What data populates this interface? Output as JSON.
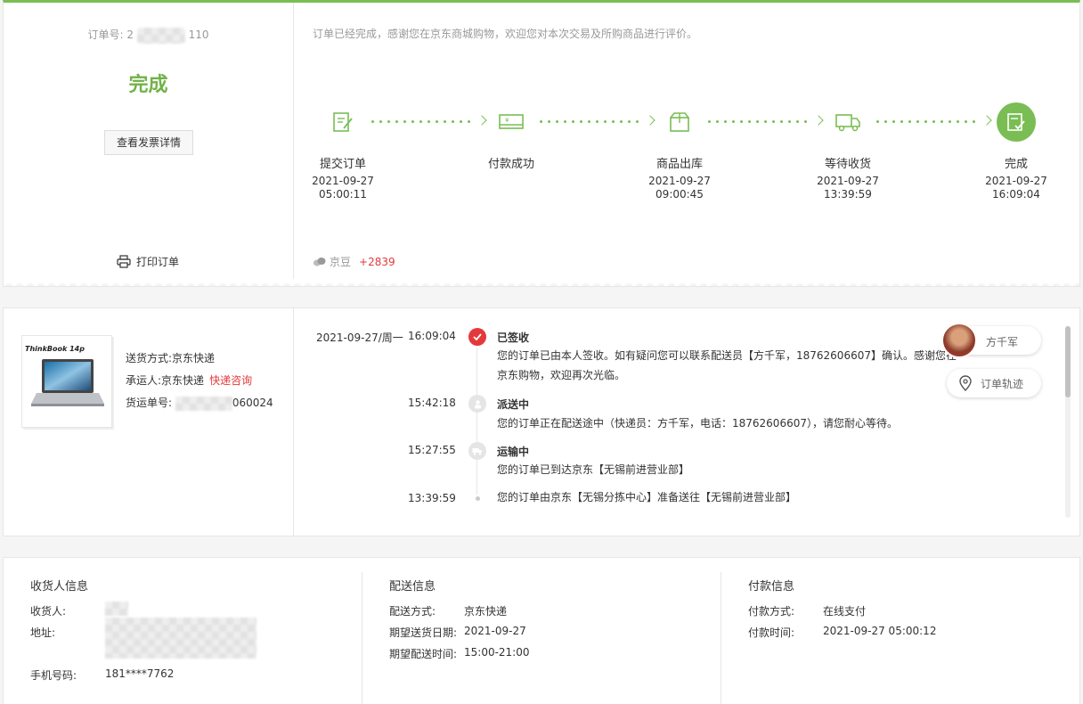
{
  "order": {
    "number_label": "订单号:",
    "number_prefix": "2",
    "number_suffix": "110",
    "status": "完成",
    "invoice_button": "查看发票详情",
    "print_label": "打印订单"
  },
  "summary": {
    "message": "订单已经完成，感谢您在京东商城购物，欢迎您对本次交易及所购商品进行评价。",
    "beans_label": "京豆",
    "beans_value": "+2839"
  },
  "progress": {
    "steps": [
      {
        "name": "提交订单",
        "date": "2021-09-27",
        "time": "05:00:11",
        "icon": "order-form-icon"
      },
      {
        "name": "付款成功",
        "date": "",
        "time": "",
        "icon": "payment-card-icon"
      },
      {
        "name": "商品出库",
        "date": "2021-09-27",
        "time": "09:00:45",
        "icon": "package-icon"
      },
      {
        "name": "等待收货",
        "date": "2021-09-27",
        "time": "13:39:59",
        "icon": "delivery-truck-icon"
      },
      {
        "name": "完成",
        "date": "2021-09-27",
        "time": "16:09:04",
        "icon": "completed-icon"
      }
    ]
  },
  "shipment": {
    "product_brand_text": "ThinkBook 14p",
    "method_label": "送货方式:",
    "method_value": "京东快递",
    "carrier_label": "承运人:",
    "carrier_value": "京东快递",
    "carrier_link": "快递咨询",
    "tracking_label": "货运单号:",
    "tracking_suffix": "060024"
  },
  "tracking": {
    "date": "2021-09-27/周一",
    "events": [
      {
        "time": "16:09:04",
        "title": "已签收",
        "desc": "您的订单已由本人签收。如有疑问您可以联系配送员【方千军，18762606607】确认。感谢您在京东购物，欢迎再次光临。",
        "icon": "check-icon"
      },
      {
        "time": "15:42:18",
        "title": "派送中",
        "desc": "您的订单正在配送途中（快递员：方千军，电话：18762606607），请您耐心等待。",
        "icon": "courier-icon"
      },
      {
        "time": "15:27:55",
        "title": "运输中",
        "desc": "您的订单已到达京东【无锡前进营业部】",
        "icon": "transport-icon"
      },
      {
        "time": "13:39:59",
        "title": "",
        "desc": "您的订单由京东【无锡分拣中心】准备送往【无锡前进营业部】",
        "icon": ""
      }
    ],
    "courier_name": "方千军",
    "trace_button": "订单轨迹"
  },
  "receiver": {
    "heading": "收货人信息",
    "name_label": "收货人:",
    "address_label": "地址:",
    "phone_label": "手机号码:",
    "phone_value": "181****7762"
  },
  "delivery": {
    "heading": "配送信息",
    "method_label": "配送方式:",
    "method_value": "京东快递",
    "date_label": "期望送货日期:",
    "date_value": "2021-09-27",
    "time_label": "期望配送时间:",
    "time_value": "15:00-21:00"
  },
  "payment": {
    "heading": "付款信息",
    "method_label": "付款方式:",
    "method_value": "在线支付",
    "time_label": "付款时间:",
    "time_value": "2021-09-27 05:00:12"
  },
  "colors": {
    "accent_green": "#7abd54",
    "status_green": "#71b247",
    "alert_red": "#e4393c"
  }
}
